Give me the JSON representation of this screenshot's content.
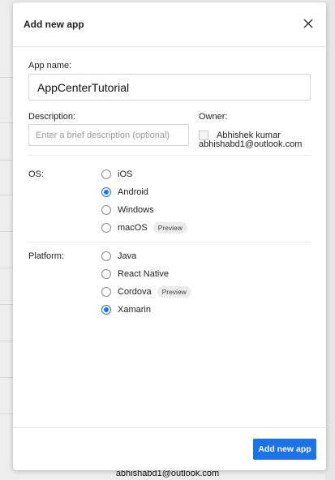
{
  "modal": {
    "title": "Add new app",
    "app_name_label": "App name:",
    "app_name_value": "AppCenterTutorial",
    "description_label": "Description:",
    "description_placeholder": "Enter a brief description (optional)",
    "owner_label": "Owner:",
    "owner_name": "Abhishek kumar",
    "owner_email": "abhishabd1@outlook.com",
    "os_label": "OS:",
    "os_options": [
      {
        "label": "iOS",
        "selected": false
      },
      {
        "label": "Android",
        "selected": true
      },
      {
        "label": "Windows",
        "selected": false
      },
      {
        "label": "macOS",
        "selected": false,
        "badge": "Preview"
      }
    ],
    "platform_label": "Platform:",
    "platform_options": [
      {
        "label": "Java",
        "selected": false
      },
      {
        "label": "React Native",
        "selected": false
      },
      {
        "label": "Cordova",
        "selected": false,
        "badge": "Preview"
      },
      {
        "label": "Xamarin",
        "selected": true
      }
    ],
    "submit_label": "Add new app"
  },
  "background": {
    "footer_email": "abhishabd1@outlook.com"
  },
  "colors": {
    "accent": "#1a73e8"
  }
}
